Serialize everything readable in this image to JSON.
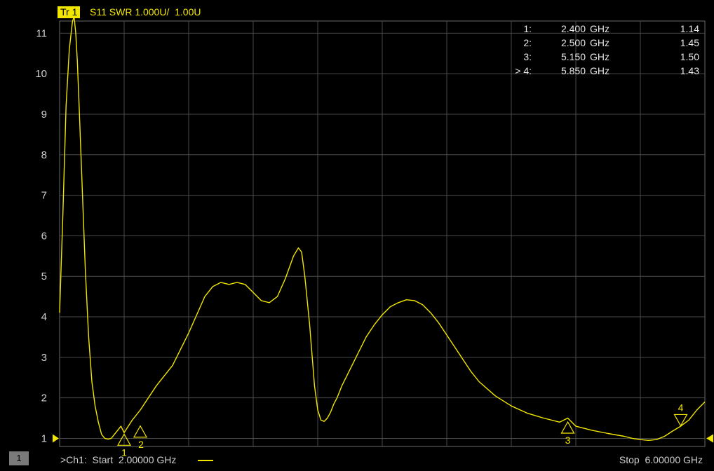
{
  "trace": {
    "tag": "Tr 1",
    "title": "S11 SWR 1.000U/  1.00U",
    "color": "#f2e600"
  },
  "channel": {
    "badge": "1",
    "start_label": ">Ch1:  Start  2.00000 GHz",
    "stop_label": "Stop  6.00000 GHz"
  },
  "markers": [
    {
      "id": "1",
      "prefix": "",
      "freq": "2.400",
      "unit": "GHz",
      "value": "1.14"
    },
    {
      "id": "2",
      "prefix": "",
      "freq": "2.500",
      "unit": "GHz",
      "value": "1.45"
    },
    {
      "id": "3",
      "prefix": "",
      "freq": "5.150",
      "unit": "GHz",
      "value": "1.50"
    },
    {
      "id": "4",
      "prefix": "> ",
      "freq": "5.850",
      "unit": "GHz",
      "value": "1.43"
    }
  ],
  "chart_data": {
    "type": "line",
    "title": "S11 SWR 1.000U/  1.00U",
    "xlabel": "",
    "ylabel": "",
    "xlim": [
      2.0,
      6.0
    ],
    "ylim": [
      0.8,
      11.3
    ],
    "yticks": [
      1,
      2,
      3,
      4,
      5,
      6,
      7,
      8,
      9,
      10,
      11
    ],
    "grid": true,
    "series": [
      {
        "x": [
          2.0,
          2.02,
          2.04,
          2.06,
          2.08,
          2.09,
          2.1,
          2.11,
          2.12,
          2.14,
          2.16,
          2.18,
          2.2,
          2.22,
          2.24,
          2.26,
          2.28,
          2.3,
          2.32,
          2.34,
          2.36,
          2.38,
          2.4,
          2.45,
          2.5,
          2.55,
          2.6,
          2.65,
          2.7,
          2.75,
          2.8,
          2.85,
          2.9,
          2.95,
          3.0,
          3.05,
          3.1,
          3.15,
          3.2,
          3.25,
          3.3,
          3.35,
          3.4,
          3.45,
          3.48,
          3.5,
          3.52,
          3.55,
          3.58,
          3.6,
          3.62,
          3.64,
          3.66,
          3.68,
          3.7,
          3.72,
          3.75,
          3.8,
          3.85,
          3.9,
          3.95,
          4.0,
          4.05,
          4.1,
          4.15,
          4.2,
          4.25,
          4.3,
          4.35,
          4.4,
          4.45,
          4.5,
          4.55,
          4.6,
          4.7,
          4.8,
          4.9,
          5.0,
          5.1,
          5.15,
          5.2,
          5.3,
          5.4,
          5.5,
          5.55,
          5.6,
          5.65,
          5.7,
          5.75,
          5.8,
          5.85,
          5.9,
          5.95,
          6.0
        ],
        "y": [
          4.1,
          6.5,
          9.2,
          10.6,
          11.3,
          11.4,
          11.0,
          10.3,
          9.3,
          7.2,
          5.1,
          3.5,
          2.4,
          1.8,
          1.4,
          1.1,
          1.0,
          0.98,
          1.0,
          1.1,
          1.2,
          1.3,
          1.14,
          1.45,
          1.7,
          2.0,
          2.3,
          2.55,
          2.8,
          3.2,
          3.6,
          4.05,
          4.5,
          4.75,
          4.85,
          4.8,
          4.85,
          4.8,
          4.6,
          4.4,
          4.35,
          4.5,
          4.95,
          5.5,
          5.7,
          5.6,
          5.0,
          3.8,
          2.3,
          1.7,
          1.45,
          1.42,
          1.5,
          1.65,
          1.85,
          2.0,
          2.3,
          2.7,
          3.1,
          3.5,
          3.8,
          4.05,
          4.25,
          4.35,
          4.42,
          4.4,
          4.3,
          4.1,
          3.85,
          3.55,
          3.25,
          2.95,
          2.65,
          2.4,
          2.05,
          1.8,
          1.62,
          1.5,
          1.4,
          1.5,
          1.3,
          1.2,
          1.12,
          1.05,
          1.0,
          0.97,
          0.95,
          0.97,
          1.05,
          1.18,
          1.3,
          1.45,
          1.7,
          1.9
        ]
      }
    ],
    "markers": [
      {
        "label": "1",
        "x": 2.4,
        "y": 0.95,
        "orientation": "up"
      },
      {
        "label": "2",
        "x": 2.5,
        "y": 1.15,
        "orientation": "up"
      },
      {
        "label": "3",
        "x": 5.15,
        "y": 1.25,
        "orientation": "up"
      },
      {
        "label": "4",
        "x": 5.85,
        "y": 1.45,
        "orientation": "down"
      }
    ]
  }
}
